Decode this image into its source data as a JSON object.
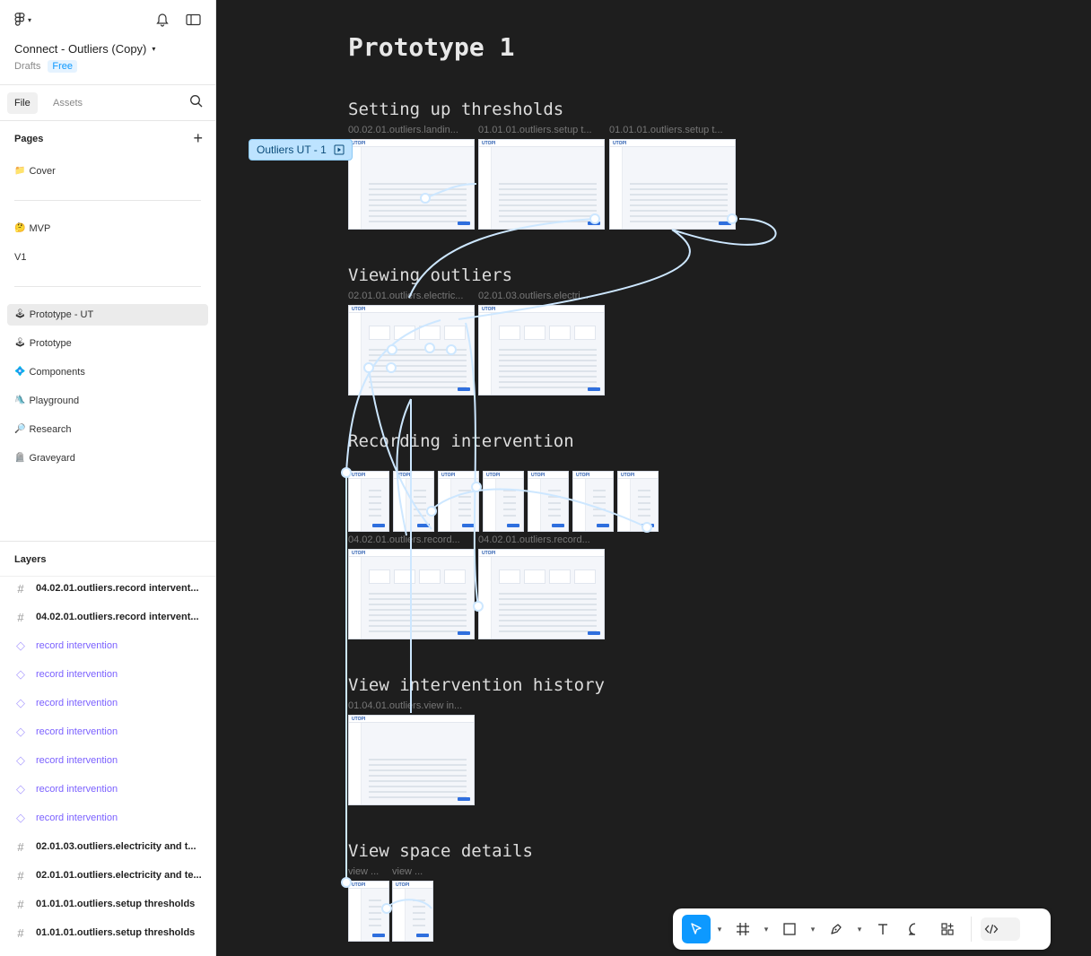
{
  "header": {
    "file_title": "Connect - Outliers (Copy)",
    "location": "Drafts",
    "plan_badge": "Free"
  },
  "tabs": {
    "file": "File",
    "assets": "Assets"
  },
  "pages": {
    "heading": "Pages",
    "groups": [
      [
        {
          "emoji": "📁",
          "label": "Cover"
        }
      ],
      [
        {
          "emoji": "🤔",
          "label": "MVP"
        },
        {
          "emoji": "",
          "label": "V1"
        }
      ],
      [
        {
          "emoji": "🕹",
          "label": "Prototype - UT",
          "active": true
        },
        {
          "emoji": "🕹",
          "label": "Prototype"
        },
        {
          "emoji": "💠",
          "label": "Components"
        },
        {
          "emoji": "🛝",
          "label": "Playground"
        },
        {
          "emoji": "🔎",
          "label": "Research"
        },
        {
          "emoji": "🪦",
          "label": "Graveyard"
        }
      ]
    ]
  },
  "layers": {
    "heading": "Layers",
    "items": [
      {
        "type": "frame",
        "label": "04.02.01.outliers.record intervent..."
      },
      {
        "type": "frame",
        "label": "04.02.01.outliers.record intervent..."
      },
      {
        "type": "instance",
        "label": "record intervention"
      },
      {
        "type": "instance",
        "label": "record intervention"
      },
      {
        "type": "instance",
        "label": "record intervention"
      },
      {
        "type": "instance",
        "label": "record intervention"
      },
      {
        "type": "instance",
        "label": "record intervention"
      },
      {
        "type": "instance",
        "label": "record intervention"
      },
      {
        "type": "instance",
        "label": "record intervention"
      },
      {
        "type": "frame",
        "label": "02.01.03.outliers.electricity and t..."
      },
      {
        "type": "frame",
        "label": "02.01.01.outliers.electricity and te..."
      },
      {
        "type": "frame",
        "label": "01.01.01.outliers.setup thresholds"
      },
      {
        "type": "frame",
        "label": "01.01.01.outliers.setup thresholds"
      }
    ]
  },
  "canvas": {
    "title": "Prototype 1",
    "flow_tag": "Outliers UT - 1",
    "sections": {
      "thresholds": "Setting up thresholds",
      "viewing": "Viewing outliers",
      "recording": "Recording intervention",
      "history": "View intervention history",
      "space": "View space details"
    },
    "frame_labels": {
      "t1": "00.02.01.outliers.landin...",
      "t2": "01.01.01.outliers.setup t...",
      "t3": "01.01.01.outliers.setup t...",
      "v1": "02.01.01.outliers.electric...",
      "v2": "02.01.03.outliers.electri...",
      "r1": "04.02.01.outliers.record...",
      "r2": "04.02.01.outliers.record...",
      "h1": "01.04.01.outliers.view in...",
      "s1": "view ...",
      "s2": "view ..."
    },
    "thumb_brand": "UTOPI"
  },
  "colors": {
    "canvas_bg": "#1e1e1e",
    "accent": "#0d99ff",
    "proto_tag_bg": "#bde3ff",
    "connector": "#cde7ff",
    "instance_text": "#7b61ff"
  }
}
